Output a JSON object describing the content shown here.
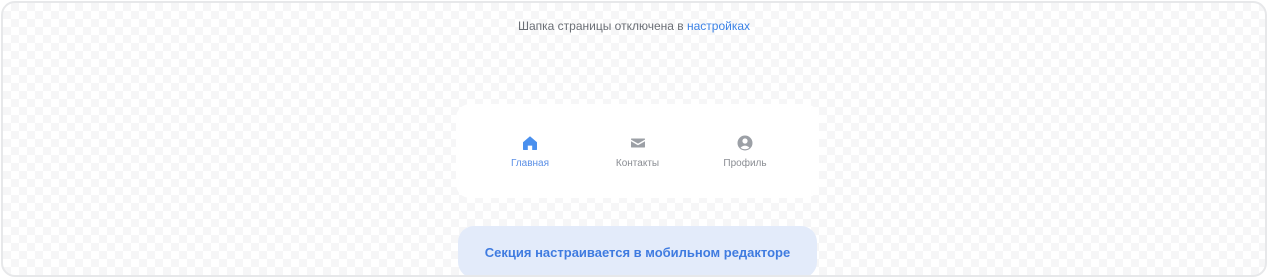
{
  "header_notice": {
    "text": "Шапка страницы отключена в ",
    "link": "настройках"
  },
  "tabbar": {
    "items": [
      {
        "label": "Главная",
        "icon": "home-icon",
        "active": true
      },
      {
        "label": "Контакты",
        "icon": "envelope-icon",
        "active": false
      },
      {
        "label": "Профиль",
        "icon": "user-circle-icon",
        "active": false
      }
    ]
  },
  "mobile_note": {
    "text": "Секция настраивается в мобильном редакторе"
  },
  "colors": {
    "accent": "#3b82e6",
    "active_icon": "#4a90ee",
    "inactive_icon": "#9ca0a6",
    "note_bg": "#e3ebfa"
  }
}
